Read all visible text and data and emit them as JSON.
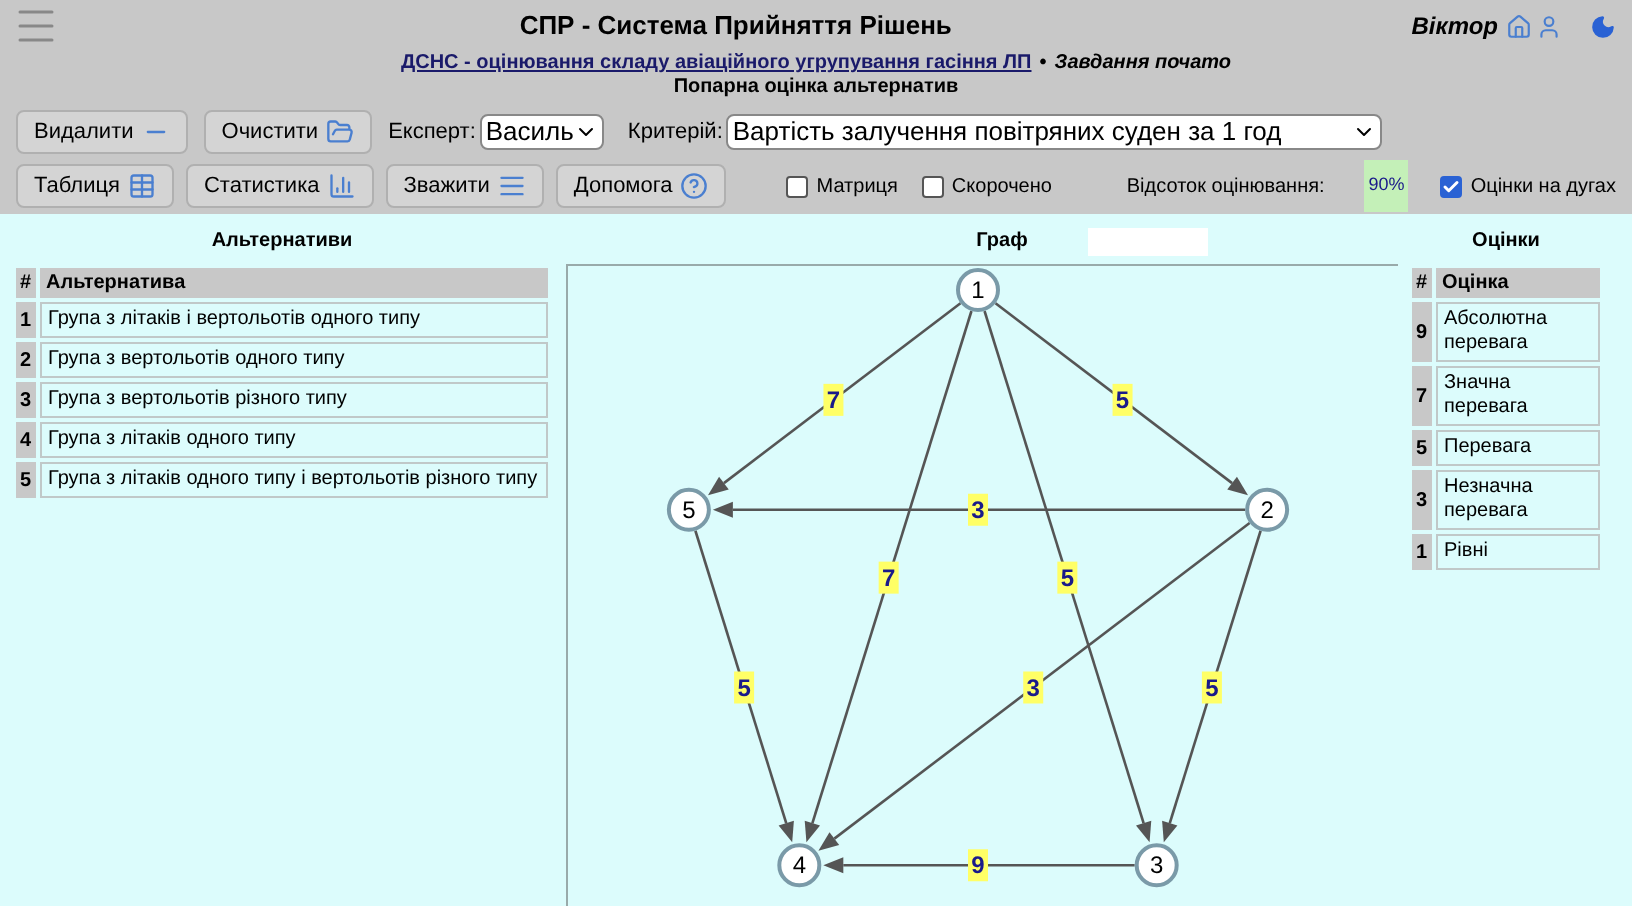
{
  "header": {
    "title": "СПР - Система Прийняття Рішень",
    "user": "Віктор"
  },
  "subheader": {
    "project_link": "ДСНС - оцінювання складу авіаційного угрупування гасіння ЛП",
    "separator": "•",
    "status": "Завдання почато",
    "page_title": "Попарна оцінка альтернатив"
  },
  "toolbar": {
    "buttons_row1": [
      {
        "label": "Видалити",
        "kind": "minus"
      },
      {
        "label": "Очистити",
        "kind": "clear"
      }
    ],
    "expert": {
      "label": "Експерт:",
      "value": "Василь"
    },
    "criterion": {
      "label": "Критерій:",
      "value": "Вартість залучення повітряних суден за 1 год"
    },
    "buttons_row2": [
      {
        "label": "Таблиця",
        "kind": "table"
      },
      {
        "label": "Статистика",
        "kind": "stats"
      },
      {
        "label": "Зважити",
        "kind": "weigh"
      },
      {
        "label": "Допомога",
        "kind": "help"
      }
    ],
    "checkboxes": [
      {
        "label": "Матриця",
        "checked": false
      },
      {
        "label": "Скорочено",
        "checked": false
      }
    ],
    "progress": {
      "label": "Відсоток оцінювання:",
      "value": "90%"
    },
    "arc_scores": {
      "label": "Оцінки на дугах",
      "checked": true
    }
  },
  "alternatives": {
    "title": "Альтернативи",
    "columns": [
      "#",
      "Альтернатива"
    ],
    "rows": [
      {
        "n": "1",
        "name": "Група з літаків і вертольотів одного типу"
      },
      {
        "n": "2",
        "name": "Група з вертольотів одного типу"
      },
      {
        "n": "3",
        "name": "Група з вертольотів різного типу"
      },
      {
        "n": "4",
        "name": "Група з літаків одного типу"
      },
      {
        "n": "5",
        "name": "Група з літаків одного типу і вертольотів різного типу"
      }
    ]
  },
  "graph": {
    "title": "Граф",
    "nodes": [
      {
        "label": "1",
        "arcs": [
          {
            "kind": "next",
            "label": "5"
          },
          {
            "kind": "skip",
            "label": "5"
          },
          {
            "kind": "back_skip",
            "label": "7"
          },
          {
            "kind": "back",
            "label": "7"
          }
        ]
      },
      {
        "label": "2",
        "arcs": [
          {
            "kind": "next",
            "label": "5"
          },
          {
            "kind": "skip",
            "label": "3"
          },
          {
            "kind": "back_skip",
            "label": "3"
          }
        ]
      },
      {
        "label": "3",
        "arcs": [
          {
            "kind": "next",
            "label": "9"
          }
        ]
      },
      {
        "label": "4"
      },
      {
        "label": "5",
        "arcs": [
          {
            "kind": "back",
            "label": "5"
          }
        ]
      }
    ]
  },
  "scores": {
    "title": "Оцінки",
    "columns": [
      "#",
      "Оцінка"
    ],
    "rows": [
      {
        "n": "9",
        "name": "Абсолютна перевага"
      },
      {
        "n": "7",
        "name": "Значна перевага"
      },
      {
        "n": "5",
        "name": "Перевага"
      },
      {
        "n": "3",
        "name": "Незначна перевага"
      },
      {
        "n": "1",
        "name": "Рівні"
      }
    ]
  }
}
